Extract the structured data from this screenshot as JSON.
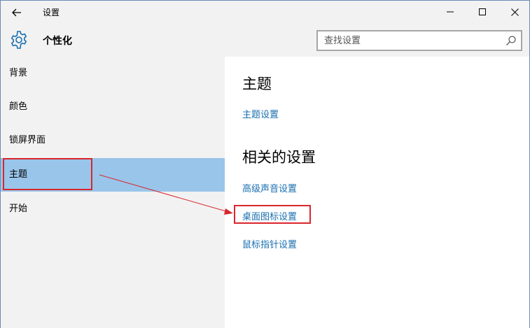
{
  "window": {
    "title": "设置",
    "accent_color": "#99c5ea",
    "link_color": "#1a6fb0",
    "annotation_color": "#d9262c"
  },
  "titlebar": {
    "back_icon": "arrow-left-icon",
    "minimize_icon": "minimize-icon",
    "maximize_icon": "maximize-icon",
    "close_icon": "close-icon"
  },
  "header": {
    "icon": "gear-icon",
    "title": "个性化"
  },
  "search": {
    "placeholder": "查找设置",
    "icon": "search-icon"
  },
  "sidebar": {
    "items": [
      {
        "label": "背景",
        "selected": false
      },
      {
        "label": "颜色",
        "selected": false
      },
      {
        "label": "锁屏界面",
        "selected": false
      },
      {
        "label": "主题",
        "selected": true
      },
      {
        "label": "开始",
        "selected": false
      }
    ]
  },
  "content": {
    "section1": {
      "title": "主题",
      "links": [
        "主题设置"
      ]
    },
    "section2": {
      "title": "相关的设置",
      "links": [
        "高级声音设置",
        "桌面图标设置",
        "鼠标指针设置"
      ]
    }
  }
}
